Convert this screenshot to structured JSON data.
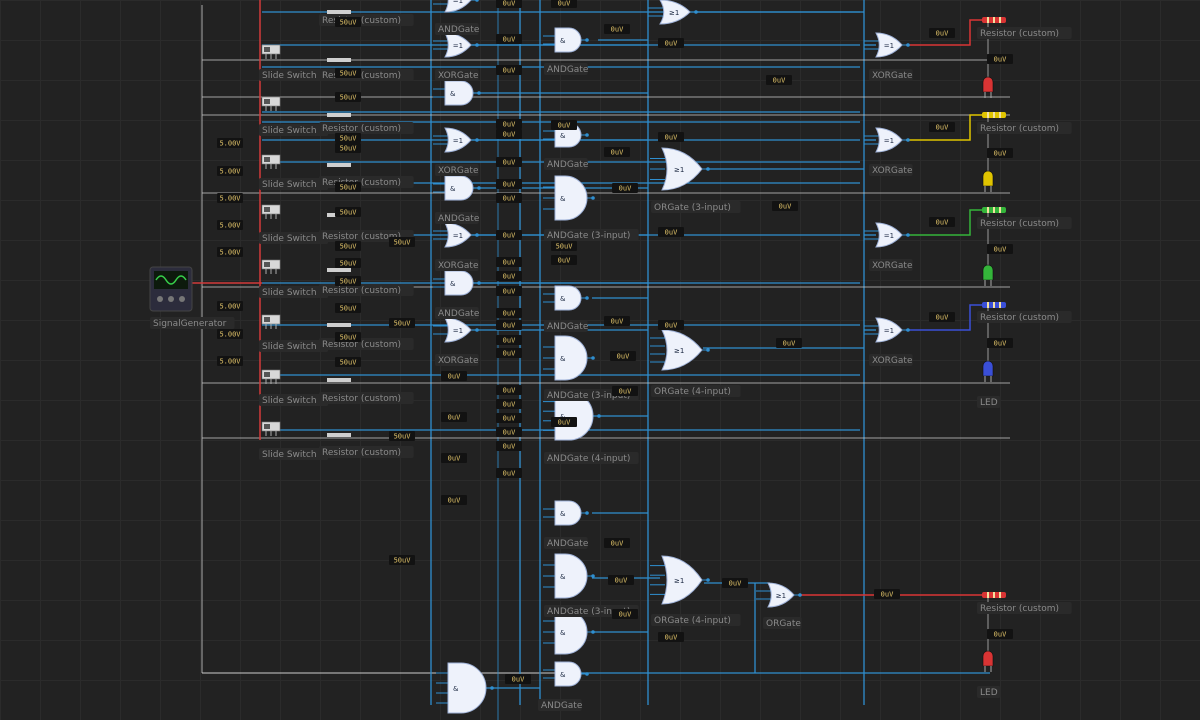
{
  "labels": {
    "slide_switch": "Slide Switch",
    "resistor": "Resistor (custom)",
    "and_gate": "ANDGate",
    "xor_gate": "XORGate",
    "or_gate": "ORGate",
    "or_gate_3": "ORGate (3-input)",
    "or_gate_4": "ORGate (4-input)",
    "and_gate_3": "ANDGate (3-input)",
    "and_gate_4": "ANDGate (4-input)",
    "led": "LED",
    "signal_generator": "SignalGenerator"
  },
  "voltages": {
    "zero": "0uV",
    "fifty": "50uV",
    "five": "5.00V"
  },
  "gate_symbols": {
    "and": "&",
    "or": "≥1",
    "xor": "=1"
  },
  "colors": {
    "background": "#222222",
    "grid": "#2b2b2b",
    "wire": "#2f8fd0",
    "power_wire": "#d23a3a",
    "led_red": "#d93434",
    "led_yellow": "#e0c400",
    "led_green": "#34b53a",
    "led_blue": "#3a4fd8",
    "voltage_text": "#e2c46a",
    "signal_green": "#37d04a"
  }
}
